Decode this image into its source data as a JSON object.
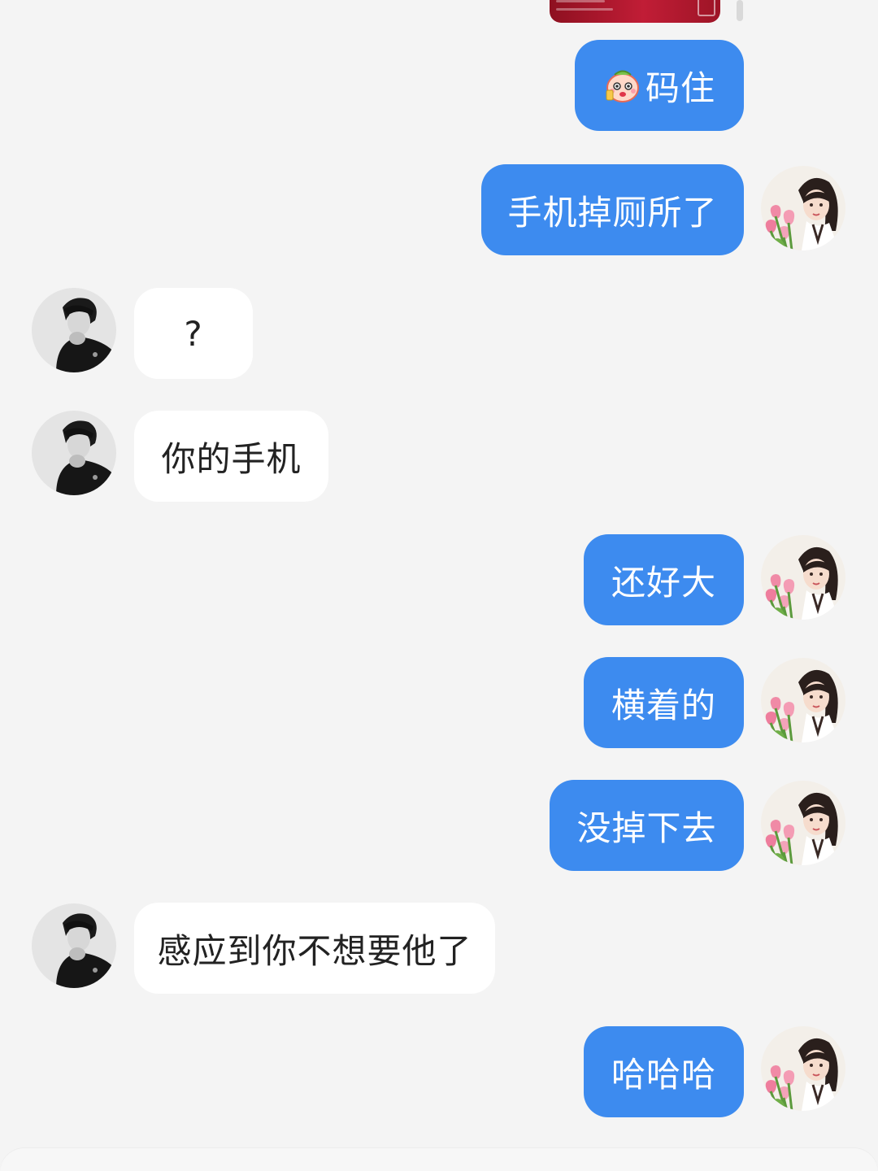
{
  "chat": {
    "messages": [
      {
        "sender": "me",
        "text": "码住",
        "sticker": "blushing-cartoon-emoji-icon"
      },
      {
        "sender": "me",
        "text": "手机掉厕所了"
      },
      {
        "sender": "them",
        "text": "?"
      },
      {
        "sender": "them",
        "text": "你的手机"
      },
      {
        "sender": "me",
        "text": "还好大"
      },
      {
        "sender": "me",
        "text": "横着的"
      },
      {
        "sender": "me",
        "text": "没掉下去"
      },
      {
        "sender": "them",
        "text": "感应到你不想要他了"
      },
      {
        "sender": "me",
        "text": "哈哈哈"
      }
    ]
  },
  "colors": {
    "background": "#f4f4f4",
    "my_bubble": "#3d8bef",
    "their_bubble": "#ffffff",
    "my_text": "#ffffff",
    "their_text": "#222222"
  },
  "icons": {
    "my_avatar": "girl-with-tulips-avatar-icon",
    "their_avatar": "man-in-black-monochrome-avatar-icon"
  }
}
